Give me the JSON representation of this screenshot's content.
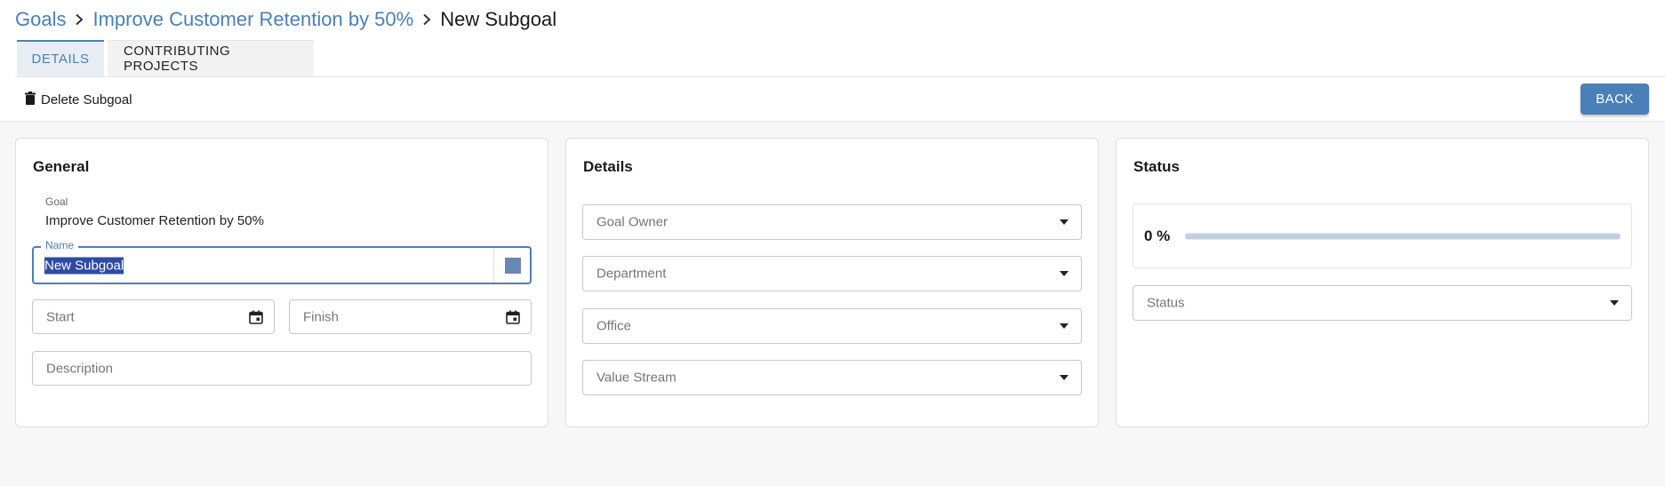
{
  "breadcrumb": {
    "root": "Goals",
    "parent": "Improve Customer Retention by 50%",
    "current": "New Subgoal"
  },
  "tabs": [
    {
      "label": "DETAILS",
      "active": true
    },
    {
      "label": "CONTRIBUTING PROJECTS",
      "active": false
    }
  ],
  "toolbar": {
    "delete_label": "Delete Subgoal",
    "back_label": "BACK"
  },
  "general": {
    "title": "General",
    "goal_label": "Goal",
    "goal_value": "Improve Customer Retention by 50%",
    "name_label": "Name",
    "name_value": "New Subgoal",
    "start_placeholder": "Start",
    "finish_placeholder": "Finish",
    "description_placeholder": "Description"
  },
  "details": {
    "title": "Details",
    "goal_owner_placeholder": "Goal Owner",
    "department_placeholder": "Department",
    "office_placeholder": "Office",
    "value_stream_placeholder": "Value Stream"
  },
  "status_panel": {
    "title": "Status",
    "progress_text": "0 %",
    "progress_fraction": 0,
    "status_placeholder": "Status"
  },
  "colors": {
    "accent": "#4a7fb8",
    "subgoal_color": "#6987b3",
    "progress_track": "#c2cfdf"
  },
  "icons": {
    "breadcrumb_separator": "chevron-right-icon",
    "delete": "trash-icon",
    "date": "calendar-icon",
    "select": "caret-down-icon"
  }
}
